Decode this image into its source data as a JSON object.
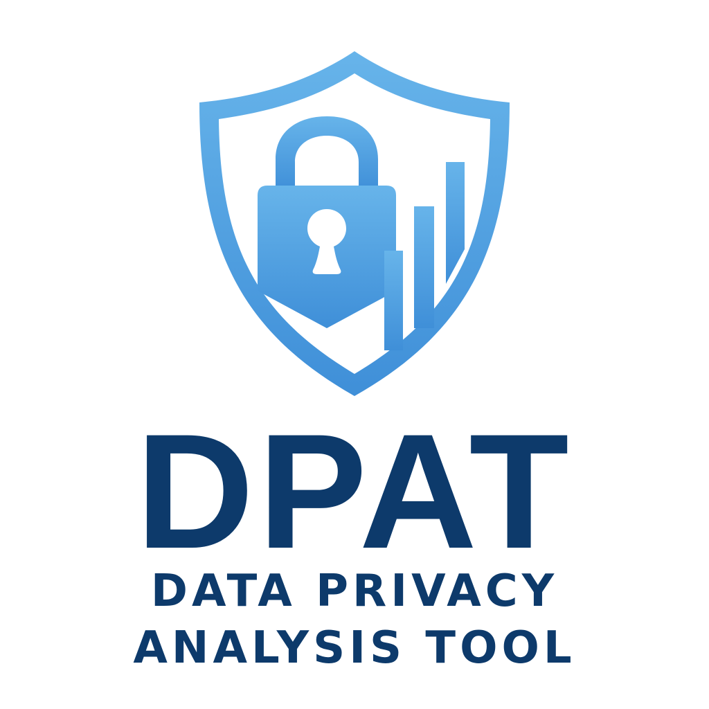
{
  "logo": {
    "emblem_icons": [
      "shield-icon",
      "padlock-icon",
      "keyhole-icon",
      "bar-chart-icon"
    ],
    "acronym": "DPAT",
    "tagline_line1": "DATA PRIVACY",
    "tagline_line2": "ANALYSIS TOOL"
  },
  "colors": {
    "emblem_light": "#67b4ea",
    "emblem_dark": "#3f8fd8",
    "text": "#0d3a6b",
    "background": "#ffffff"
  }
}
